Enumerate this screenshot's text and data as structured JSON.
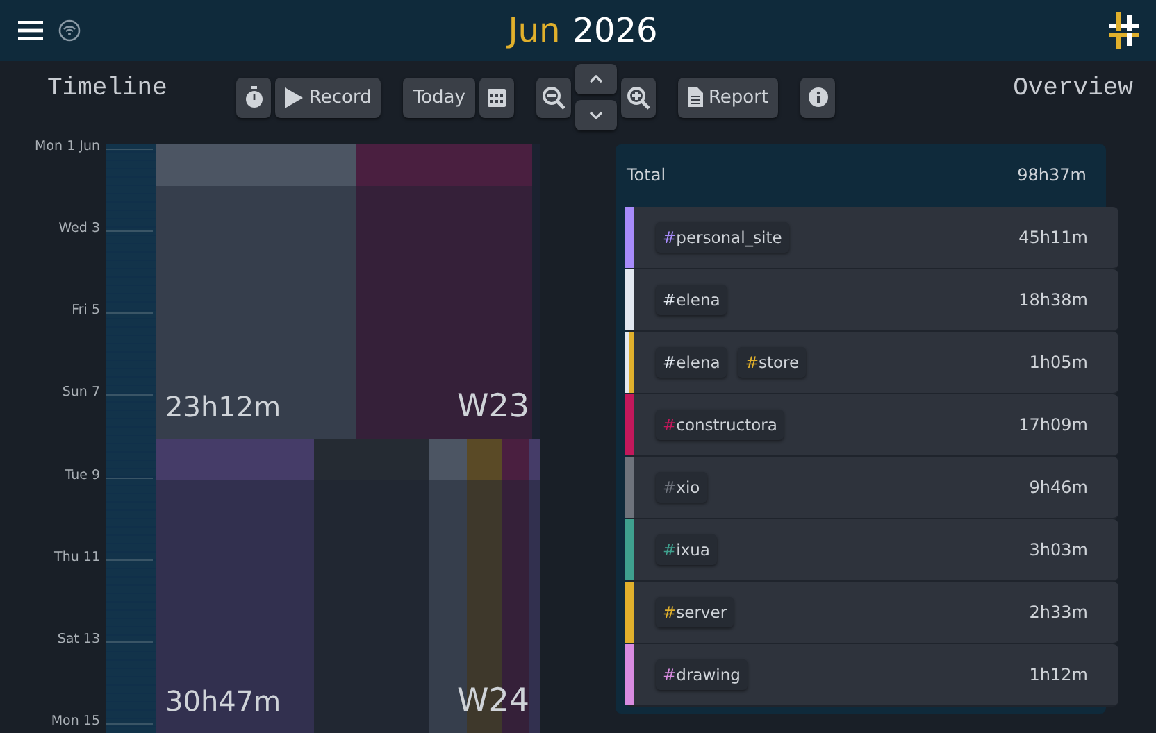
{
  "header": {
    "month": "Jun",
    "year": "2026"
  },
  "toolbar": {
    "record": "Record",
    "today": "Today",
    "report": "Report"
  },
  "timeline": {
    "title": "Timeline",
    "days": [
      "Mon 1 Jun",
      "Wed 3",
      "Fri 5",
      "Sun 7",
      "Tue 9",
      "Thu 11",
      "Sat 13",
      "Mon 15"
    ],
    "weeks": [
      {
        "label": "W23",
        "total": "23h12m",
        "segments": [
          {
            "color": "#4c5563"
          },
          {
            "color": "#4a1f40"
          }
        ]
      },
      {
        "label": "W24",
        "total": "30h47m",
        "segments": [
          {
            "color": "#453c68"
          },
          {
            "color": "#252b33"
          },
          {
            "color": "#4c5563"
          },
          {
            "color": "#5a4a26"
          },
          {
            "color": "#4a1f40"
          },
          {
            "color": "#453c68"
          }
        ]
      }
    ]
  },
  "overview": {
    "title": "Overview",
    "total_label": "Total",
    "total": "98h37m",
    "items": [
      {
        "tags": [
          {
            "text": "#personal_site",
            "color": "#a78bfa"
          }
        ],
        "duration": "45h11m"
      },
      {
        "tags": [
          {
            "text": "#elena",
            "color": "#e2e8f0"
          }
        ],
        "duration": "18h38m"
      },
      {
        "tags": [
          {
            "text": "#elena",
            "color": "#e2e8f0"
          },
          {
            "text": "#store",
            "color": "#e0b02c"
          }
        ],
        "duration": "1h05m"
      },
      {
        "tags": [
          {
            "text": "#constructora",
            "color": "#c2185b"
          }
        ],
        "duration": "17h09m"
      },
      {
        "tags": [
          {
            "text": "#xio",
            "color": "#6e737c"
          }
        ],
        "duration": "9h46m"
      },
      {
        "tags": [
          {
            "text": "#ixua",
            "color": "#3fa08e"
          }
        ],
        "duration": "3h03m"
      },
      {
        "tags": [
          {
            "text": "#server",
            "color": "#e0b02c"
          }
        ],
        "duration": "2h33m"
      },
      {
        "tags": [
          {
            "text": "#drawing",
            "color": "#d88be0"
          }
        ],
        "duration": "1h12m"
      }
    ]
  }
}
